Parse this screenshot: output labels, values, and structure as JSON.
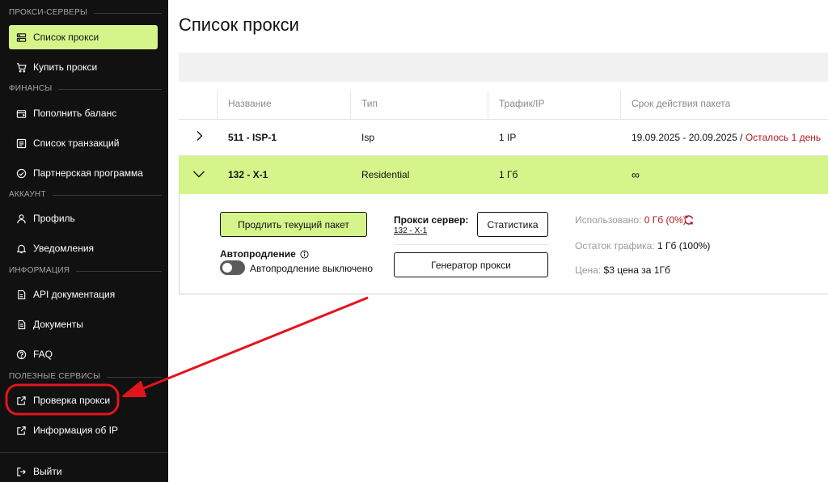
{
  "sidebar": {
    "sections": {
      "proxy_servers": "ПРОКСИ-СЕРВЕРЫ",
      "finance": "ФИНАНСЫ",
      "account": "АККАУНТ",
      "info": "ИНФОРМАЦИЯ",
      "services": "ПОЛЕЗНЫЕ СЕРВИСЫ"
    },
    "items": [
      {
        "label": "Список прокси",
        "icon": "server-icon",
        "active": true
      },
      {
        "label": "Купить прокси",
        "icon": "cart-icon"
      },
      {
        "label": "Пополнить баланс",
        "icon": "wallet-icon"
      },
      {
        "label": "Список транзакций",
        "icon": "list-icon"
      },
      {
        "label": "Партнерская программа",
        "icon": "partner-icon"
      },
      {
        "label": "Профиль",
        "icon": "user-icon"
      },
      {
        "label": "Уведомления",
        "icon": "bell-icon"
      },
      {
        "label": "API документация",
        "icon": "api-doc-icon"
      },
      {
        "label": "Документы",
        "icon": "documents-icon"
      },
      {
        "label": "FAQ",
        "icon": "question-icon"
      },
      {
        "label": "Проверка прокси",
        "icon": "external-link-icon"
      },
      {
        "label": "Информация об IP",
        "icon": "external-link-icon"
      },
      {
        "label": "Выйти",
        "icon": "logout-icon"
      }
    ]
  },
  "main": {
    "title": "Список прокси",
    "columns": [
      "Название",
      "Тип",
      "Трафик/IP",
      "Срок действия пакета"
    ],
    "rows": [
      {
        "name": "511 - ISP-1",
        "type": "Isp",
        "traffic": "1 IP",
        "period": "19.09.2025 - 20.09.2025",
        "separator": "/",
        "remaining": "Осталось 1 день"
      },
      {
        "name": "132 - X-1",
        "type": "Residential",
        "traffic": "1 Гб",
        "period": "∞"
      }
    ],
    "details": {
      "extend_button": "Продлить текущий пакет",
      "autorenew_label": "Автопродление",
      "autorenew_status": "Автопродление выключено",
      "proxy_server_label": "Прокси сервер:",
      "proxy_server_link": "132 - X-1",
      "stats_button": "Статистика",
      "generator_button": "Генератор прокси",
      "used_label": "Использовано:",
      "used_value": "0 Гб (0%)",
      "remaining_label": "Остаток трафика:",
      "remaining_value": "1 Гб (100%)",
      "price_label": "Цена:",
      "price_value": "$3 цена за 1Гб"
    }
  },
  "colors": {
    "accent": "#d5f58a",
    "sidebar_bg": "#111111",
    "alert_red": "#b11a22",
    "annotation_red": "#e3141c"
  }
}
